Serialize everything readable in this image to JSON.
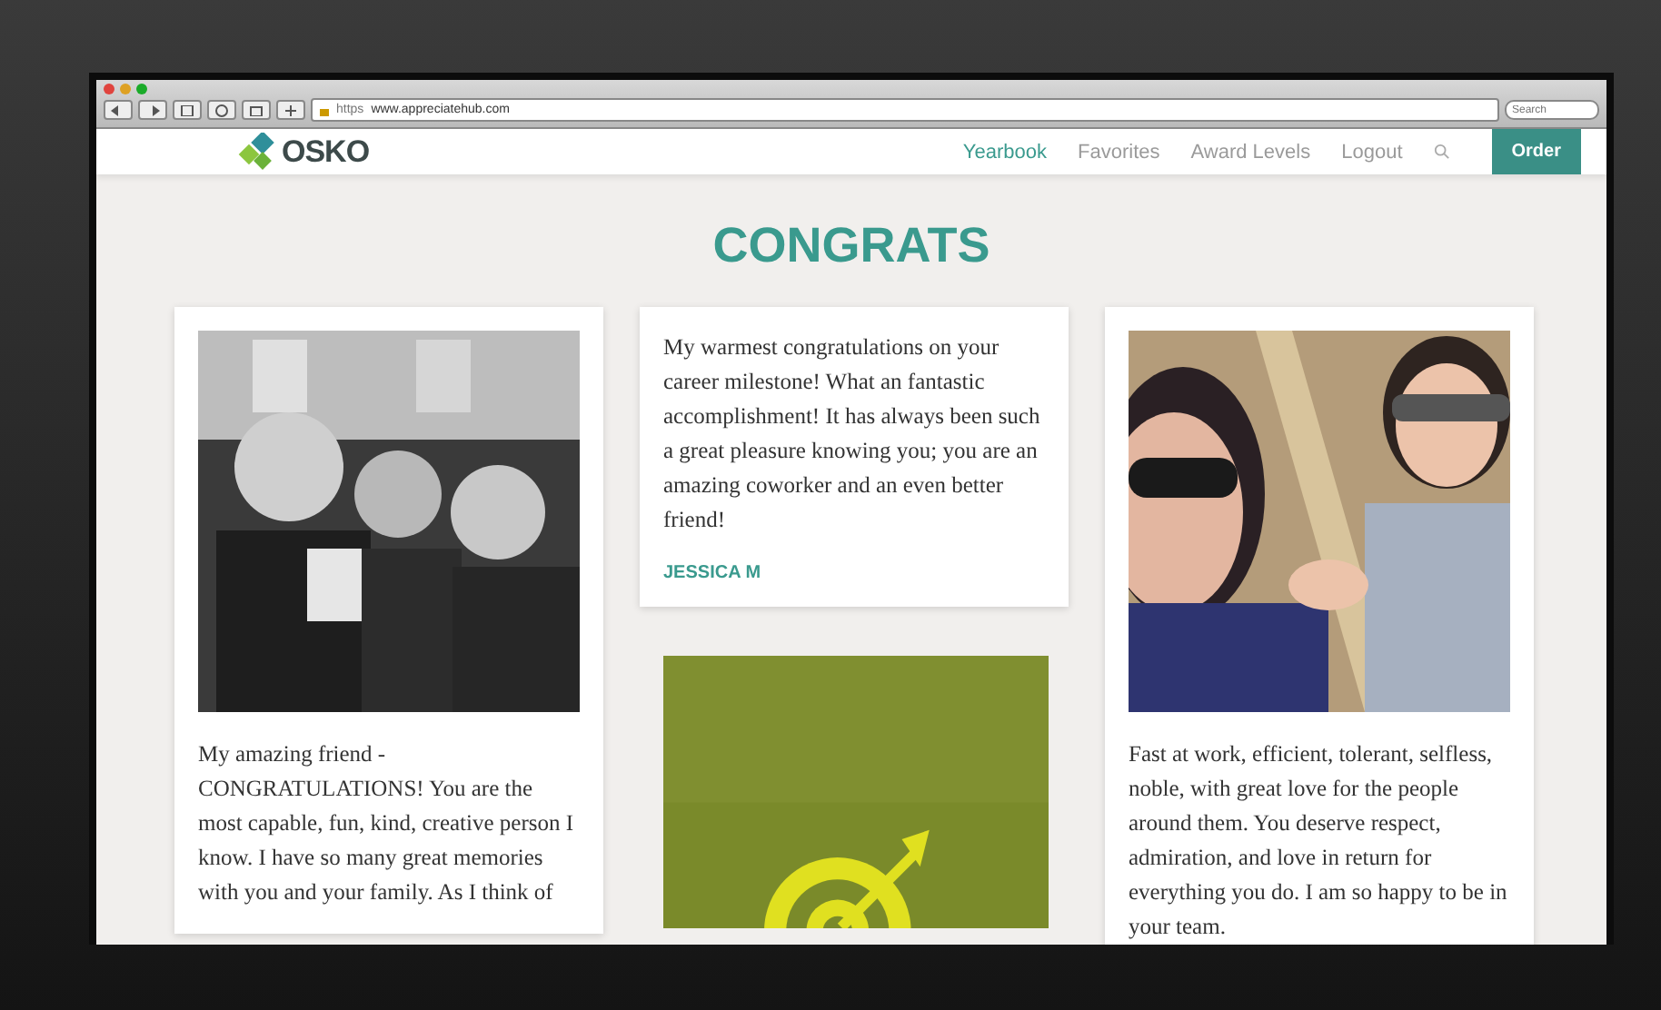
{
  "browser": {
    "scheme": "https",
    "url": "www.appreciatehub.com",
    "search_placeholder": "Search"
  },
  "nav": {
    "logo": "OSKO",
    "items": [
      {
        "label": "Yearbook",
        "selected": true
      },
      {
        "label": "Favorites",
        "selected": false
      },
      {
        "label": "Award Levels",
        "selected": false
      },
      {
        "label": "Logout",
        "selected": false
      }
    ],
    "order_button": "Order"
  },
  "heading": "CONGRATS",
  "columns": [
    [
      {
        "message": "My amazing friend - CONGRATULATIONS! You are the most capable, fun, kind, creative person I know. I have so many great memories with you and your family.  As I think of"
      }
    ],
    [
      {
        "kind": "note",
        "message": "My warmest congratulations on your career milestone! What an fantastic accomplishment! It has always been such a great pleasure knowing you; you are an amazing coworker and an even better friend!",
        "author": "JESSICA M"
      },
      {
        "kind": "picture"
      }
    ],
    [
      {
        "message": "Fast at work, efficient, tolerant, selfless, noble, with great love for the people around them. You deserve respect, admiration, and love in return for everything you do. I am so happy to be in your team."
      }
    ]
  ]
}
